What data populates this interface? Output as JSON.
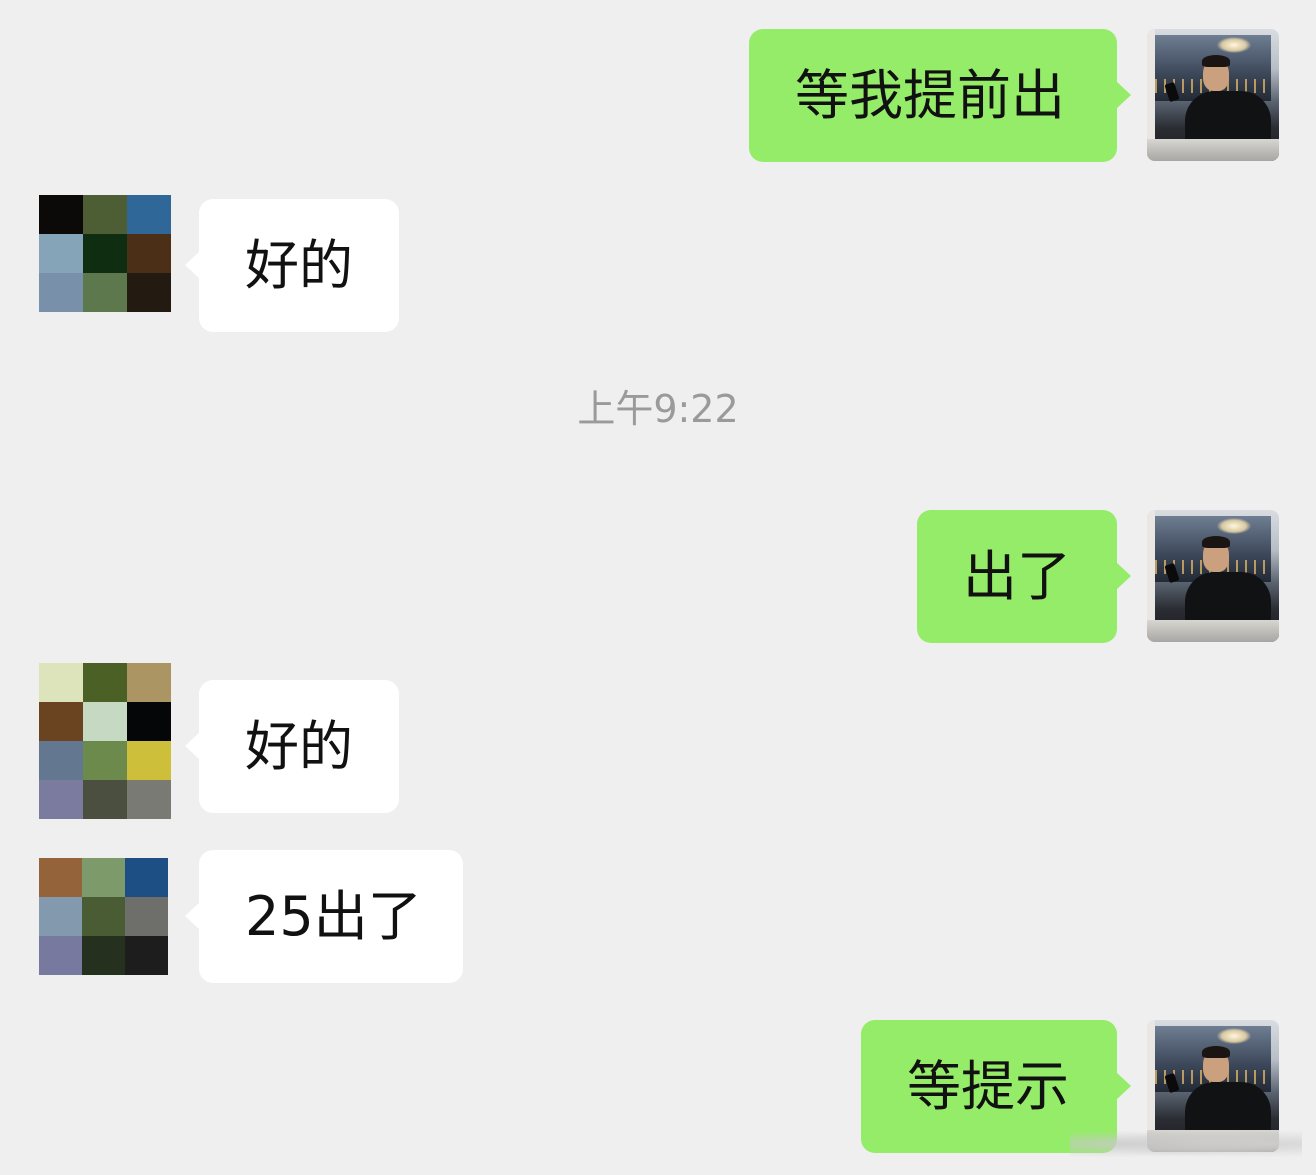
{
  "chat": {
    "timestamp": "上午9:22",
    "messages": [
      {
        "direction": "out",
        "text": "等我提前出"
      },
      {
        "direction": "in",
        "text": "好的"
      },
      {
        "direction": "out",
        "text": "出了"
      },
      {
        "direction": "in",
        "text": "好的"
      },
      {
        "direction": "in",
        "text": "25出了"
      },
      {
        "direction": "out",
        "text": "等提示"
      }
    ]
  },
  "colors": {
    "background": "#efefef",
    "outgoing_bubble": "#95ec69",
    "incoming_bubble": "#ffffff",
    "timestamp_text": "#9a9a9a"
  },
  "avatars": {
    "self": "photo-avatar",
    "contact_1_mosaic": [
      "#0b0a08",
      "#4d5d34",
      "#2f6898",
      "#85a4b8",
      "#0f2d11",
      "#4b2f17",
      "#7990aa",
      "#5e784d",
      "#231a12"
    ],
    "contact_2_mosaic": [
      "#dde3bb",
      "#4a6024",
      "#ab9663",
      "#6a4320",
      "#c6d9c3",
      "#040608",
      "#637890",
      "#6b8a4b",
      "#cdbf3a",
      "#7b7ba0",
      "#4b4f40",
      "#7a7a74"
    ],
    "contact_3_mosaic": [
      "#95633a",
      "#7d9a6a",
      "#1e4f84",
      "#8299ae",
      "#4a5c34",
      "#6e6e6a",
      "#77799f",
      "#26301e",
      "#1d1d1d"
    ]
  }
}
